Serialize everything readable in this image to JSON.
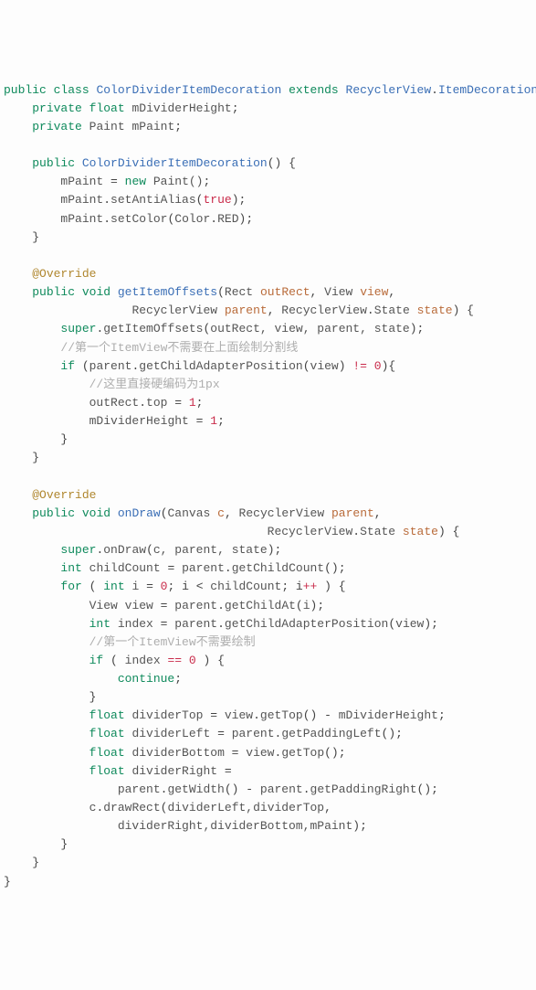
{
  "code": {
    "l1": {
      "kw1": "public",
      "kw2": "class",
      "cls": "ColorDividerItemDecoration",
      "kw3": "extends",
      "sup": "RecyclerView",
      "sup2": "ItemDecoration"
    },
    "l2": {
      "kw": "private",
      "kw2": "float",
      "name": "mDividerHeight"
    },
    "l3": {
      "kw": "private",
      "typ": "Paint",
      "name": "mPaint"
    },
    "l5": {
      "kw": "public",
      "cls": "ColorDividerItemDecoration"
    },
    "l6": {
      "lhs": "mPaint",
      "kw": "new",
      "rhs": "Paint()"
    },
    "l7": {
      "obj": "mPaint",
      "m": "setAntiAlias",
      "arg": "true"
    },
    "l8": {
      "obj": "mPaint",
      "m": "setColor",
      "cls": "Color",
      "fld": "RED"
    },
    "l10": {
      "ann": "@Override"
    },
    "l11": {
      "kw": "public",
      "kw2": "void",
      "m": "getItemOffsets",
      "t1": "Rect",
      "p1": "outRect",
      "t2": "View",
      "p2": "view"
    },
    "l12": {
      "t3": "RecyclerView",
      "p3": "parent",
      "t4": "RecyclerView",
      "t4b": "State",
      "p4": "state"
    },
    "l13": {
      "kw": "super",
      "m": "getItemOffsets",
      "a": "outRect, view, parent, state"
    },
    "l14": {
      "c": "//第一个ItemView不需要在上面绘制分割线"
    },
    "l15": {
      "kw": "if",
      "obj": "parent",
      "m": "getChildAdapterPosition",
      "arg": "view",
      "op": "!=",
      "num": "0"
    },
    "l16": {
      "c": "//这里直接硬编码为1px"
    },
    "l17": {
      "obj": "outRect",
      "f": "top",
      "num": "1"
    },
    "l18": {
      "lhs": "mDividerHeight",
      "num": "1"
    },
    "l21": {
      "ann": "@Override"
    },
    "l22": {
      "kw": "public",
      "kw2": "void",
      "m": "onDraw",
      "t1": "Canvas",
      "p1": "c",
      "t2": "RecyclerView",
      "p2": "parent"
    },
    "l23": {
      "t3": "RecyclerView",
      "t3b": "State",
      "p3": "state"
    },
    "l24": {
      "kw": "super",
      "m": "onDraw",
      "a": "c, parent, state"
    },
    "l25": {
      "kw": "int",
      "name": "childCount",
      "obj": "parent",
      "m": "getChildCount"
    },
    "l26": {
      "kw": "for",
      "kw2": "int",
      "v": "i",
      "n0": "0",
      "cond": "childCount",
      "op": "++"
    },
    "l27": {
      "t": "View",
      "name": "view",
      "obj": "parent",
      "m": "getChildAt",
      "arg": "i"
    },
    "l28": {
      "kw": "int",
      "name": "index",
      "obj": "parent",
      "m": "getChildAdapterPosition",
      "arg": "view"
    },
    "l29": {
      "c": "//第一个ItemView不需要绘制"
    },
    "l30": {
      "kw": "if",
      "v": "index",
      "op": "==",
      "num": "0"
    },
    "l31": {
      "kw": "continue"
    },
    "l33": {
      "kw": "float",
      "name": "dividerTop",
      "obj": "view",
      "m": "getTop",
      "rhs": "mDividerHeight"
    },
    "l34": {
      "kw": "float",
      "name": "dividerLeft",
      "obj": "parent",
      "m": "getPaddingLeft"
    },
    "l35": {
      "kw": "float",
      "name": "dividerBottom",
      "obj": "view",
      "m": "getTop"
    },
    "l36": {
      "kw": "float",
      "name": "dividerRight"
    },
    "l37": {
      "obj1": "parent",
      "m1": "getWidth",
      "obj2": "parent",
      "m2": "getPaddingRight"
    },
    "l38": {
      "obj": "c",
      "m": "drawRect",
      "a": "dividerLeft,dividerTop"
    },
    "l39": {
      "a": "dividerRight,dividerBottom,mPaint"
    }
  }
}
